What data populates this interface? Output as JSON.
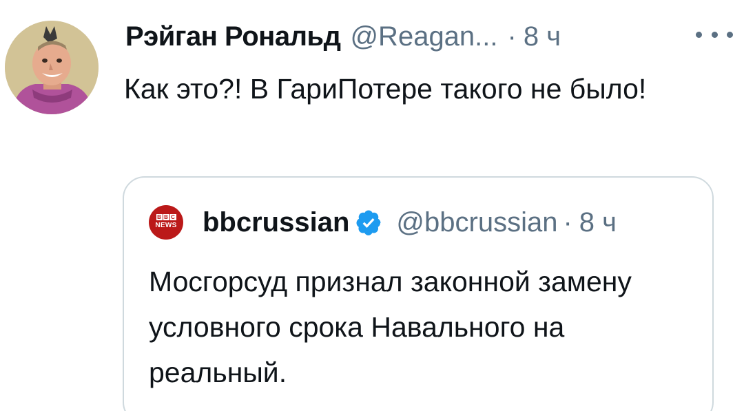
{
  "tweet": {
    "display_name": "Рэйган Рональд",
    "handle": "@Reagan...",
    "separator": "·",
    "time": "8 ч",
    "text": "Как это?! В ГариПотере такого не было!",
    "more_icon": "more-horizontal-icon"
  },
  "quoted_tweet": {
    "avatar_logo_letters": [
      "B",
      "B",
      "C"
    ],
    "avatar_logo_news": "NEWS",
    "display_name": "bbcrussian",
    "verified_icon": "verified-badge-icon",
    "handle": "@bbcrussian",
    "separator": "·",
    "time": "8 ч",
    "text": "Мосгорсуд признал законной замену условного срока Навального на реальный."
  },
  "colors": {
    "text_primary": "#0f1419",
    "text_secondary": "#5b7083",
    "verified_blue": "#1d9bf0",
    "quote_border": "#cfd9de",
    "bbc_red": "#bb1919"
  }
}
